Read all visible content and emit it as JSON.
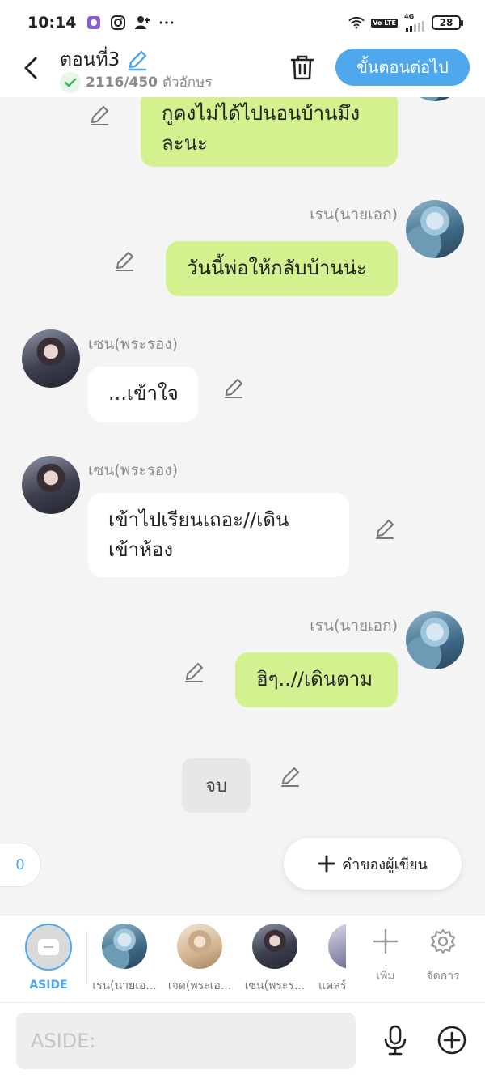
{
  "status_bar": {
    "time": "10:14",
    "network_type": "4G",
    "volte": "Vo LTE",
    "battery": "28"
  },
  "header": {
    "title": "ตอนที่3",
    "char_count": "2116/450",
    "char_unit": "ตัวอักษร",
    "next_button": "ขั้นตอนต่อไป"
  },
  "messages": [
    {
      "side": "right",
      "speaker": "",
      "text": "กูคงไม่ได้ไปนอนบ้านมึงละนะ",
      "line1": "กูคงไม่ได้ไปนอนบ้านมึง",
      "line2": "ละนะ"
    },
    {
      "side": "right",
      "speaker": "เรน(นายเอก)",
      "text": "วันนี้พ่อให้กลับบ้านน่ะ"
    },
    {
      "side": "left",
      "speaker": "เซน(พระรอง)",
      "text": "...เข้าใจ"
    },
    {
      "side": "left",
      "speaker": "เซน(พระรอง)",
      "text": "เข้าไปเรียนเถอะ//เดินเข้าห้อง",
      "line1": "เข้าไปเรียนเถอะ//เดิน",
      "line2": "เข้าห้อง"
    },
    {
      "side": "right",
      "speaker": "เรน(นายเอก)",
      "text": "ฮิๆ..//เดินตาม"
    }
  ],
  "end_marker": "จบ",
  "counter": "0",
  "author_note_button": "คำของผู้เขียน",
  "character_bar": {
    "aside_label": "ASIDE",
    "characters": [
      {
        "label": "เรน(นายเอ...",
        "avatar": "ren"
      },
      {
        "label": "เจด(พระเอ...",
        "avatar": "jed"
      },
      {
        "label": "เซน(พระร...",
        "avatar": "zen"
      },
      {
        "label": "แคลร์",
        "avatar": "claire"
      }
    ],
    "add_label": "เพิ่ม",
    "manage_label": "จัดการ"
  },
  "input": {
    "placeholder": "ASIDE:"
  },
  "colors": {
    "accent": "#4fa8ec",
    "bubble_green": "#d3f28f",
    "bubble_white": "#ffffff",
    "check_green": "#3dbb61"
  }
}
